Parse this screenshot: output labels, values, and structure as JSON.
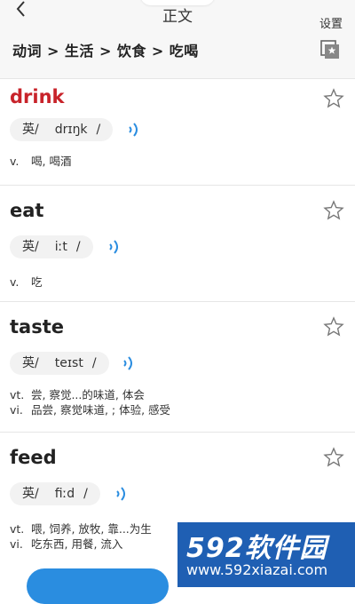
{
  "header": {
    "title": "正文",
    "settings_label": "设置",
    "breadcrumb": [
      "动词",
      "生活",
      "饮食",
      "吃喝"
    ],
    "breadcrumb_sep": ">"
  },
  "words": [
    {
      "word": "drink",
      "accent": "英/",
      "ipa": "drɪŋk",
      "close": "/",
      "defs": [
        {
          "pos": "v.",
          "text": "喝, 喝酒"
        }
      ]
    },
    {
      "word": "eat",
      "accent": "英/",
      "ipa": "iːt",
      "close": "/",
      "defs": [
        {
          "pos": "v.",
          "text": "吃"
        }
      ]
    },
    {
      "word": "taste",
      "accent": "英/",
      "ipa": "teɪst",
      "close": "/",
      "defs": [
        {
          "pos": "vt.",
          "text": "尝, 察觉...的味道, 体会"
        },
        {
          "pos": "vi.",
          "text": "品尝, 察觉味道, ; 体验, 感受"
        }
      ]
    },
    {
      "word": "feed",
      "accent": "英/",
      "ipa": "fiːd",
      "close": "/",
      "defs": [
        {
          "pos": "vt.",
          "text": "喂, 饲养, 放牧, 靠...为生"
        },
        {
          "pos": "vi.",
          "text": "吃东西, 用餐, 流入"
        }
      ]
    }
  ],
  "watermark": {
    "brand": "592软件园",
    "url": "www.592xiazai.com"
  },
  "colors": {
    "highlight_word": "#c8232a",
    "accent_blue": "#2a8de0"
  },
  "icons": [
    "back-arrow-icon",
    "favorites-folder-icon",
    "star-outline-icon",
    "sound-icon"
  ]
}
